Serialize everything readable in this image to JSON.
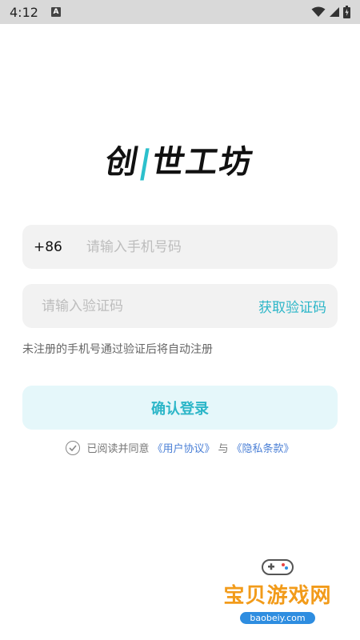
{
  "status": {
    "time": "4:12",
    "a_icon": "A"
  },
  "logo": {
    "text_part1": "创",
    "text_part2": "世工坊",
    "accent_mark": "|"
  },
  "phone": {
    "prefix": "+86",
    "placeholder": "请输入手机号码"
  },
  "code": {
    "placeholder": "请输入验证码",
    "button": "获取验证码"
  },
  "hint": "未注册的手机号通过验证后将自动注册",
  "login_button": "确认登录",
  "agreement": {
    "prefix": "已阅读并同意",
    "user_agreement": "《用户协议》",
    "conjunction": "与",
    "privacy_policy": "《隐私条款》"
  },
  "watermark": {
    "title": "宝贝游戏网",
    "url": "baobeiy.com"
  },
  "colors": {
    "accent": "#2cb6c8",
    "link": "#4a7fd6",
    "field_bg": "#f2f2f2"
  }
}
